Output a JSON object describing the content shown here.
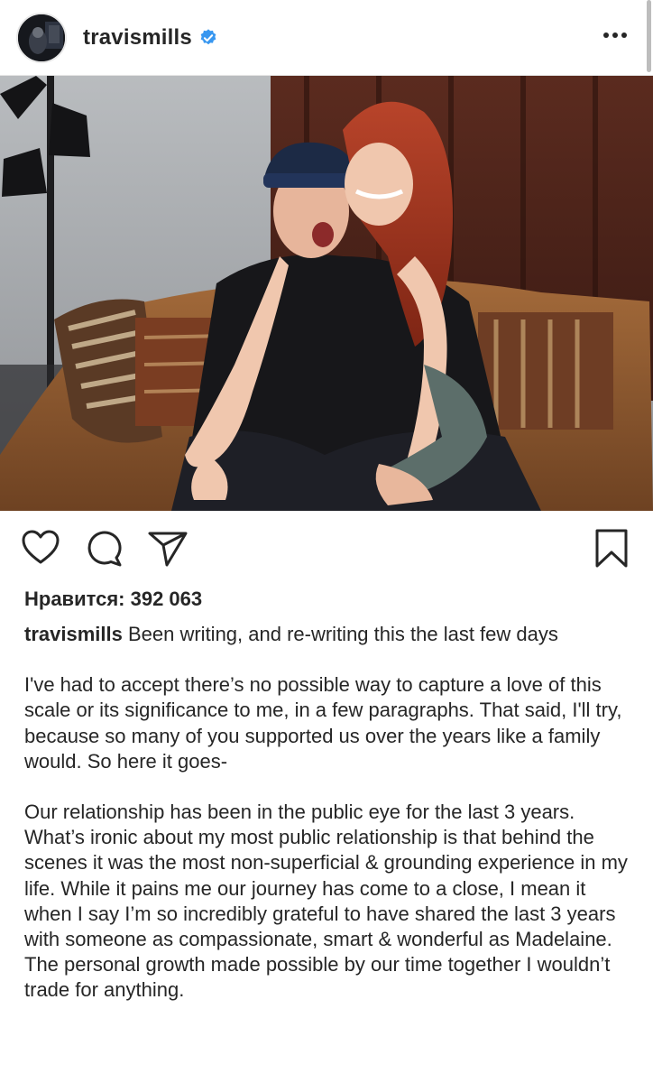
{
  "post": {
    "username": "travismills",
    "verified": true,
    "likes_text": "Нравится: 392 063",
    "caption_first": "Been writing, and re-writing this the last few days",
    "paragraphs": [
      "I've had to accept there’s no possible way to capture a love of this scale or its significance to me, in a few paragraphs. That said, I'll try, because so many of you supported us over the years like a family would. So here it goes-",
      "Our relationship has been in the public eye for the last 3 years. What’s ironic about my most public relationship is that behind the scenes it was the most non-superficial & grounding experience in my life. While it pains me our journey has come to a close, I mean it when I say I’m so incredibly grateful to have shared the last 3 years with someone as compassionate, smart & wonderful as Madelaine. The personal growth made possible by our time together I wouldn’t trade for anything."
    ]
  },
  "icons": {
    "verified": "verified-badge-icon",
    "more": "more-options-icon",
    "like": "heart-icon",
    "comment": "comment-icon",
    "share": "share-icon",
    "save": "bookmark-icon"
  },
  "colors": {
    "text": "#262626",
    "verified_blue": "#3897f0",
    "divider": "#e6e6e6"
  }
}
